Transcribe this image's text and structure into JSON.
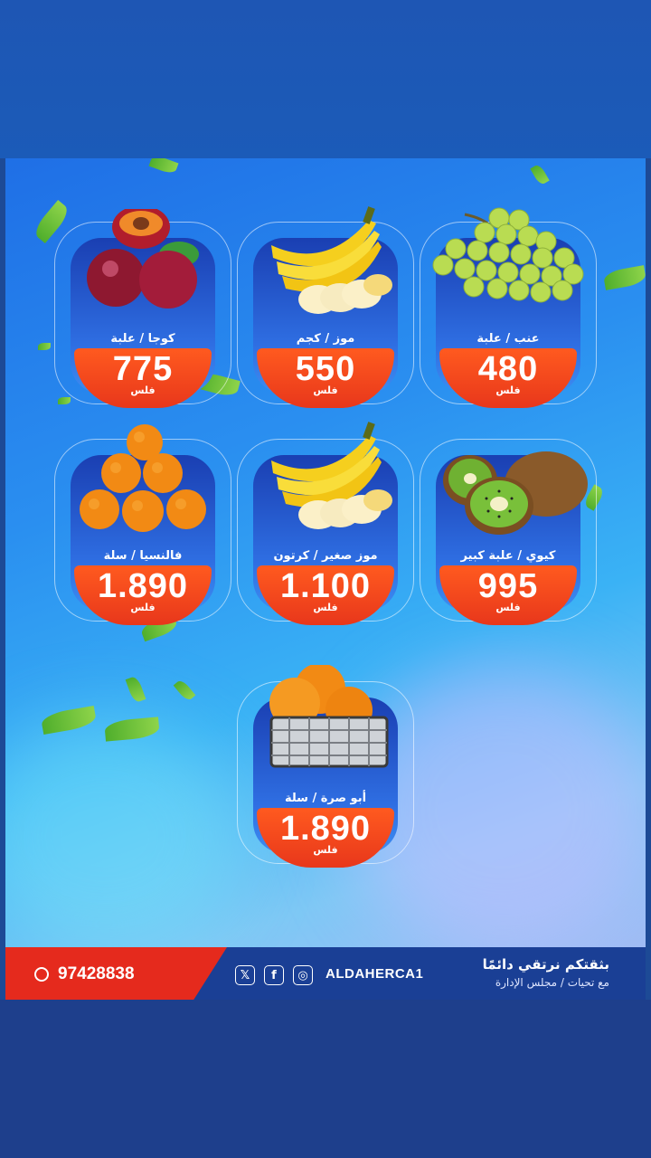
{
  "products": [
    {
      "name": "كوجا / علبة",
      "price": "775",
      "unit": "فلس",
      "icon": "plum-icon"
    },
    {
      "name": "موز / كجم",
      "price": "550",
      "unit": "فلس",
      "icon": "banana-icon"
    },
    {
      "name": "عنب / علبة",
      "price": "480",
      "unit": "فلس",
      "icon": "grapes-icon"
    },
    {
      "name": "فالنسيا / سلة",
      "price": "1.890",
      "unit": "فلس",
      "icon": "orange-icon"
    },
    {
      "name": "موز صغير / كرتون",
      "price": "1.100",
      "unit": "فلس",
      "icon": "banana-icon"
    },
    {
      "name": "كيوي / علبة كبير",
      "price": "995",
      "unit": "فلس",
      "icon": "kiwi-icon"
    },
    {
      "name": "أبو صرة / سلة",
      "price": "1.890",
      "unit": "فلس",
      "icon": "orange-basket-icon"
    }
  ],
  "footer": {
    "phone": "97428838",
    "handle": "ALDAHERCA1",
    "slogan": "بثقتكم نرتقي دائمًا",
    "subline": "مع تحيات / مجلس الإدارة",
    "social_icons": [
      "x-icon",
      "facebook-icon",
      "instagram-icon",
      "whatsapp-icon"
    ]
  },
  "colors": {
    "price_red": "#e8371b",
    "panel_blue": "#1a3fb2",
    "footer_blue": "#1a3f95"
  }
}
